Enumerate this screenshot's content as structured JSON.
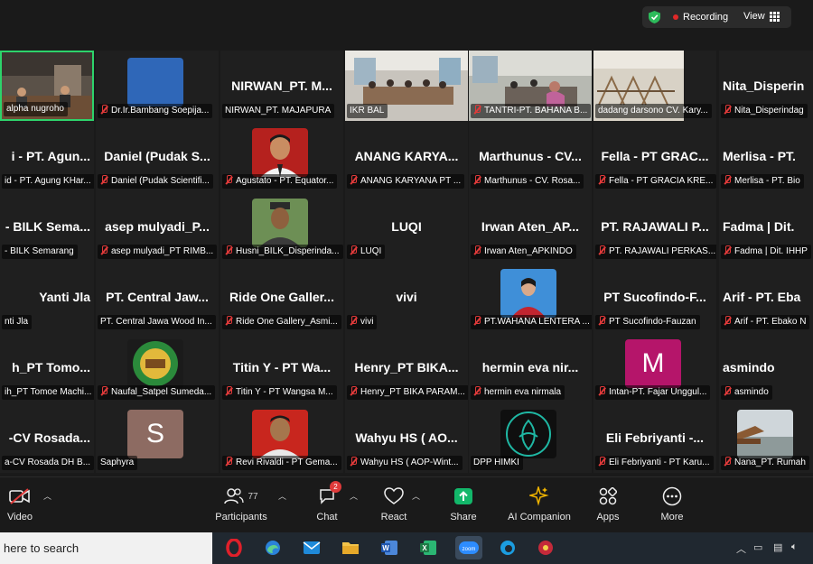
{
  "status": {
    "recording_label": "Recording",
    "view_label": "View",
    "colors": {
      "shield": "#2dbb5b",
      "record": "#e02828"
    }
  },
  "tiles": [
    {
      "name": "",
      "label": "alpha nugroho",
      "kind": "video",
      "muted": false,
      "active": true
    },
    {
      "name": "",
      "label": "Dr.Ir.Bambang Soepija...",
      "kind": "avatar",
      "muted": true,
      "avatar": "blue-square"
    },
    {
      "name": "NIRWAN_PT. M...",
      "label": "NIRWAN_PT. MAJAPURA",
      "kind": "name",
      "muted": false
    },
    {
      "name": "",
      "label": "IKR BAL",
      "kind": "video",
      "muted": false
    },
    {
      "name": "",
      "label": "TANTRI-PT. BAHANA B...",
      "kind": "video",
      "muted": true
    },
    {
      "name": "",
      "label": "dadang darsono CV. Kary...",
      "kind": "video",
      "muted": false
    },
    {
      "name": "Nita_Disperin",
      "label": "Nita_Disperindag",
      "kind": "name",
      "muted": true
    },
    {
      "name": "i - PT. Agun...",
      "label": "id - PT. Agung KHar...",
      "kind": "name",
      "muted": false
    },
    {
      "name": "Daniel (Pudak S...",
      "label": "Daniel (Pudak Scientifi...",
      "kind": "name",
      "muted": true
    },
    {
      "name": "",
      "label": "Agustato - PT. Equator...",
      "kind": "avatar",
      "muted": true,
      "avatar": "man-red"
    },
    {
      "name": "ANANG KARYA...",
      "label": "ANANG KARYANA PT ...",
      "kind": "name",
      "muted": true
    },
    {
      "name": "Marthunus - CV...",
      "label": "Marthunus - CV. Rosa...",
      "kind": "name",
      "muted": true
    },
    {
      "name": "Fella - PT GRAC...",
      "label": "Fella - PT GRACIA KRE...",
      "kind": "name",
      "muted": true
    },
    {
      "name": "Merlisa - PT.",
      "label": "Merlisa - PT. Bio",
      "kind": "name",
      "muted": true
    },
    {
      "name": "- BILK Sema...",
      "label": "- BILK Semarang",
      "kind": "name",
      "muted": false
    },
    {
      "name": "asep mulyadi_P...",
      "label": "asep mulyadi_PT RIMB...",
      "kind": "name",
      "muted": true
    },
    {
      "name": "",
      "label": "Husni_BILK_Disperinda...",
      "kind": "avatar",
      "muted": true,
      "avatar": "man-green"
    },
    {
      "name": "LUQI",
      "label": "LUQI",
      "kind": "name",
      "muted": true
    },
    {
      "name": "Irwan Aten_AP...",
      "label": "Irwan Aten_APKINDO",
      "kind": "name",
      "muted": true
    },
    {
      "name": "PT. RAJAWALI P...",
      "label": "PT. RAJAWALI PERKAS...",
      "kind": "name",
      "muted": true
    },
    {
      "name": "Fadma | Dit.",
      "label": "Fadma | Dit. IHHP",
      "kind": "name",
      "muted": true
    },
    {
      "name": "Yanti Jla",
      "label": "nti Jla",
      "kind": "name",
      "muted": false
    },
    {
      "name": "PT. Central Jaw...",
      "label": "PT. Central Jawa Wood In...",
      "kind": "name",
      "muted": false
    },
    {
      "name": "Ride One Galler...",
      "label": "Ride One Gallery_Asmi...",
      "kind": "name",
      "muted": true
    },
    {
      "name": "vivi",
      "label": "vivi",
      "kind": "name",
      "muted": true
    },
    {
      "name": "",
      "label": "PT.WAHANA LENTERA ...",
      "kind": "avatar",
      "muted": true,
      "avatar": "person-blue"
    },
    {
      "name": "PT Sucofindo-F...",
      "label": "PT Sucofindo-Fauzan",
      "kind": "name",
      "muted": true
    },
    {
      "name": "Arif - PT. Eba",
      "label": "Arif - PT. Ebako N",
      "kind": "name",
      "muted": true
    },
    {
      "name": "h_PT Tomo...",
      "label": "ih_PT Tomoe Machi...",
      "kind": "name",
      "muted": false
    },
    {
      "name": "",
      "label": "Naufal_Satpel Sumeda...",
      "kind": "avatar",
      "muted": true,
      "avatar": "logo-green"
    },
    {
      "name": "Titin Y - PT Wa...",
      "label": "Titin Y - PT Wangsa M...",
      "kind": "name",
      "muted": true
    },
    {
      "name": "Henry_PT BIKA...",
      "label": "Henry_PT BIKA PARAM...",
      "kind": "name",
      "muted": true
    },
    {
      "name": "hermin eva nir...",
      "label": "hermin eva nirmala",
      "kind": "name",
      "muted": true
    },
    {
      "name": "",
      "label": "Intan-PT. Fajar Unggul...",
      "kind": "avatar",
      "muted": true,
      "avatar": "letter",
      "letter": "M",
      "color": "#b5156a"
    },
    {
      "name": "asmindo",
      "label": "asmindo",
      "kind": "name",
      "muted": true
    },
    {
      "name": "-CV Rosada...",
      "label": "a-CV Rosada DH B...",
      "kind": "name",
      "muted": false
    },
    {
      "name": "",
      "label": "Saphyra",
      "kind": "avatar",
      "muted": false,
      "avatar": "letter",
      "letter": "S",
      "color": "#8d6b62"
    },
    {
      "name": "",
      "label": "Revi Rivaldi - PT Gema...",
      "kind": "avatar",
      "muted": true,
      "avatar": "man-red2"
    },
    {
      "name": "Wahyu HS ( AO...",
      "label": "Wahyu HS ( AOP-Wint...",
      "kind": "name",
      "muted": true
    },
    {
      "name": "",
      "label": "DPP HIMKI",
      "kind": "avatar",
      "muted": false,
      "avatar": "logo-himki"
    },
    {
      "name": "Eli Febriyanti -...",
      "label": "Eli Febriyanti - PT Karu...",
      "kind": "name",
      "muted": true
    },
    {
      "name": "",
      "label": "Nana_PT. Rumah",
      "kind": "avatar",
      "muted": true,
      "avatar": "photo-lake"
    }
  ],
  "toolbar": {
    "video": "Video",
    "participants": "Participants",
    "participant_count": "77",
    "chat": "Chat",
    "chat_badge": "2",
    "react": "React",
    "share": "Share",
    "ai": "AI Companion",
    "apps": "Apps",
    "more": "More",
    "share_color": "#12b76a"
  },
  "taskbar": {
    "search_placeholder": "here to search",
    "zoom_label": "zoom"
  }
}
